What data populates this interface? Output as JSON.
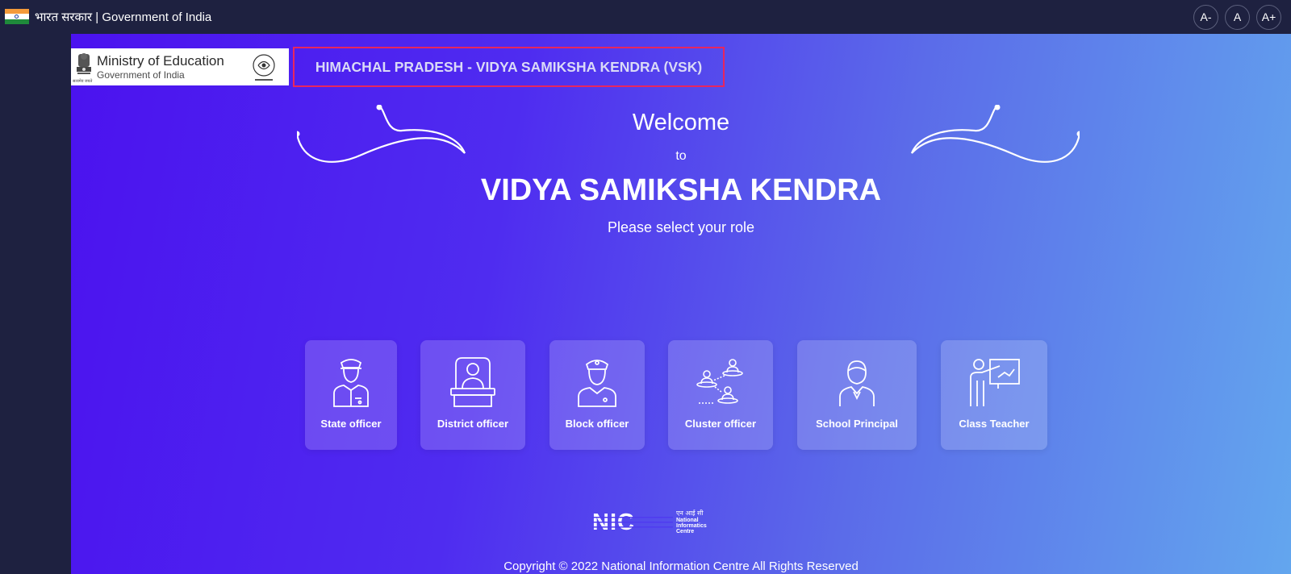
{
  "topbar": {
    "gov_label": "भारत सरकार | Government of India",
    "font_buttons": [
      "A-",
      "A",
      "A+"
    ]
  },
  "header": {
    "ministry_title": "Ministry of Education",
    "ministry_sub": "Government of India",
    "emblem_caption": "सत्यमेव जयते",
    "state_title": "HIMACHAL PRADESH - VIDYA SAMIKSHA KENDRA (VSK)"
  },
  "hero": {
    "welcome": "Welcome",
    "to": "to",
    "title": "VIDYA SAMIKSHA KENDRA",
    "subtitle": "Please select your role"
  },
  "roles": [
    {
      "label": "State officer",
      "icon": "state-officer-icon"
    },
    {
      "label": "District officer",
      "icon": "district-officer-icon"
    },
    {
      "label": "Block officer",
      "icon": "block-officer-icon"
    },
    {
      "label": "Cluster officer",
      "icon": "cluster-officer-icon"
    },
    {
      "label": "School Principal",
      "icon": "school-principal-icon"
    },
    {
      "label": "Class Teacher",
      "icon": "class-teacher-icon"
    }
  ],
  "footer": {
    "nic_hindi": "एन आई सी",
    "nic_text": "National Informatics Centre",
    "copyright": "Copyright © 2022 National Information Centre All Rights Reserved"
  },
  "colors": {
    "topbar": "#1e2140",
    "gradient_start": "#4b12ef",
    "gradient_end": "#63a6ee",
    "title_border": "#e8265e"
  }
}
